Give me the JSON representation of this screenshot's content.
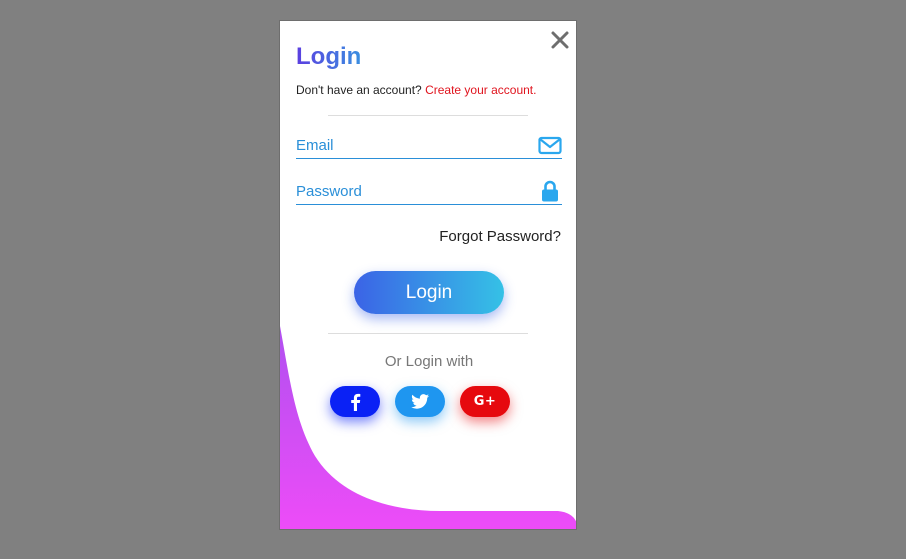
{
  "modal": {
    "title": "Login",
    "close_icon": "close-icon"
  },
  "signup": {
    "prompt": "Don't have an account?",
    "link": "Create your account."
  },
  "form": {
    "email_placeholder": "Email",
    "email_icon": "envelope-icon",
    "password_placeholder": "Password",
    "password_icon": "lock-icon",
    "forgot_label": "Forgot Password?",
    "login_label": "Login"
  },
  "social": {
    "or_label": "Or Login with",
    "facebook_icon": "facebook-icon",
    "twitter_icon": "twitter-icon",
    "google_plus_label": "G+"
  },
  "colors": {
    "accent_blue": "#2a8fd8",
    "link_red": "#e0141e",
    "facebook": "#0a21f5",
    "twitter": "#1e96f0",
    "google": "#e6090e",
    "blob_start": "#b050f0",
    "blob_end": "#ee4cf8"
  }
}
